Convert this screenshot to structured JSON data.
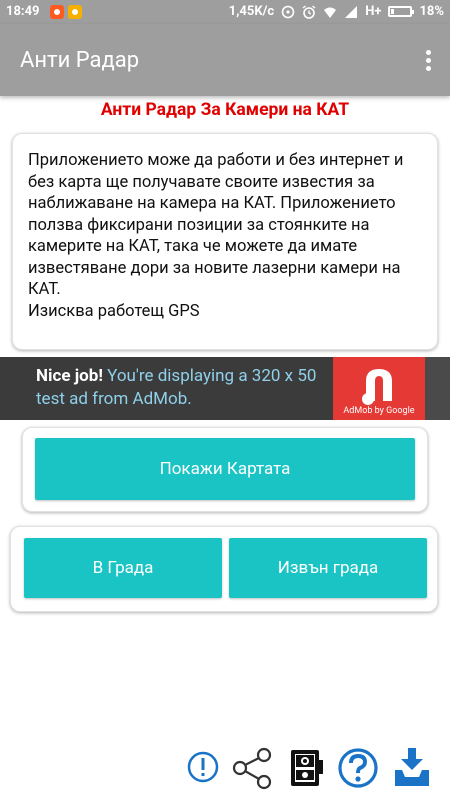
{
  "status_bar": {
    "time": "18:49",
    "network_speed": "1,45K/c",
    "network_type": "H+",
    "battery": "18%",
    "battery_level": 0.18,
    "icons": [
      "notification-app-icon",
      "mi-app-icon",
      "hotspot-icon",
      "alarm-icon",
      "wifi-icon",
      "signal-icon",
      "battery-icon"
    ]
  },
  "app_bar": {
    "title": "Анти Радар",
    "menu_icon": "overflow-menu-icon"
  },
  "headline": "Анти Радар За Камери на КАТ",
  "info_card": {
    "paragraph": "Приложението може да работи и без интернет и без карта ще получавате своите известия за наближаване на камера на КАТ. Приложението ползва фиксирани позиции за стоянките на камерите на КАТ, така че можете да имате известяване дори за новите лазерни камери на КАТ.",
    "gps_note": "Изисква работещ GPS"
  },
  "ad_banner": {
    "lead": "Nice job!",
    "text": " You're displaying a 320 x 50 test ad from AdMob.",
    "logo_caption": "AdMob by Google"
  },
  "buttons": {
    "show_map": "Покажи Картата",
    "in_city": "В Града",
    "out_of_city": "Извън града"
  },
  "bottom_bar": {
    "icons": [
      "info-icon",
      "share-icon",
      "speed-camera-icon",
      "help-icon",
      "download-icon"
    ]
  },
  "colors": {
    "status_bar_bg": "#9e9e9e",
    "app_bar_bg": "#9e9e9e",
    "headline": "#e00000",
    "button": "#1bc4c4",
    "ad_bg": "#3b3b3b",
    "ad_text": "#8fd0ea",
    "admob_red": "#e53935",
    "icon_blue": "#1a73c7"
  }
}
